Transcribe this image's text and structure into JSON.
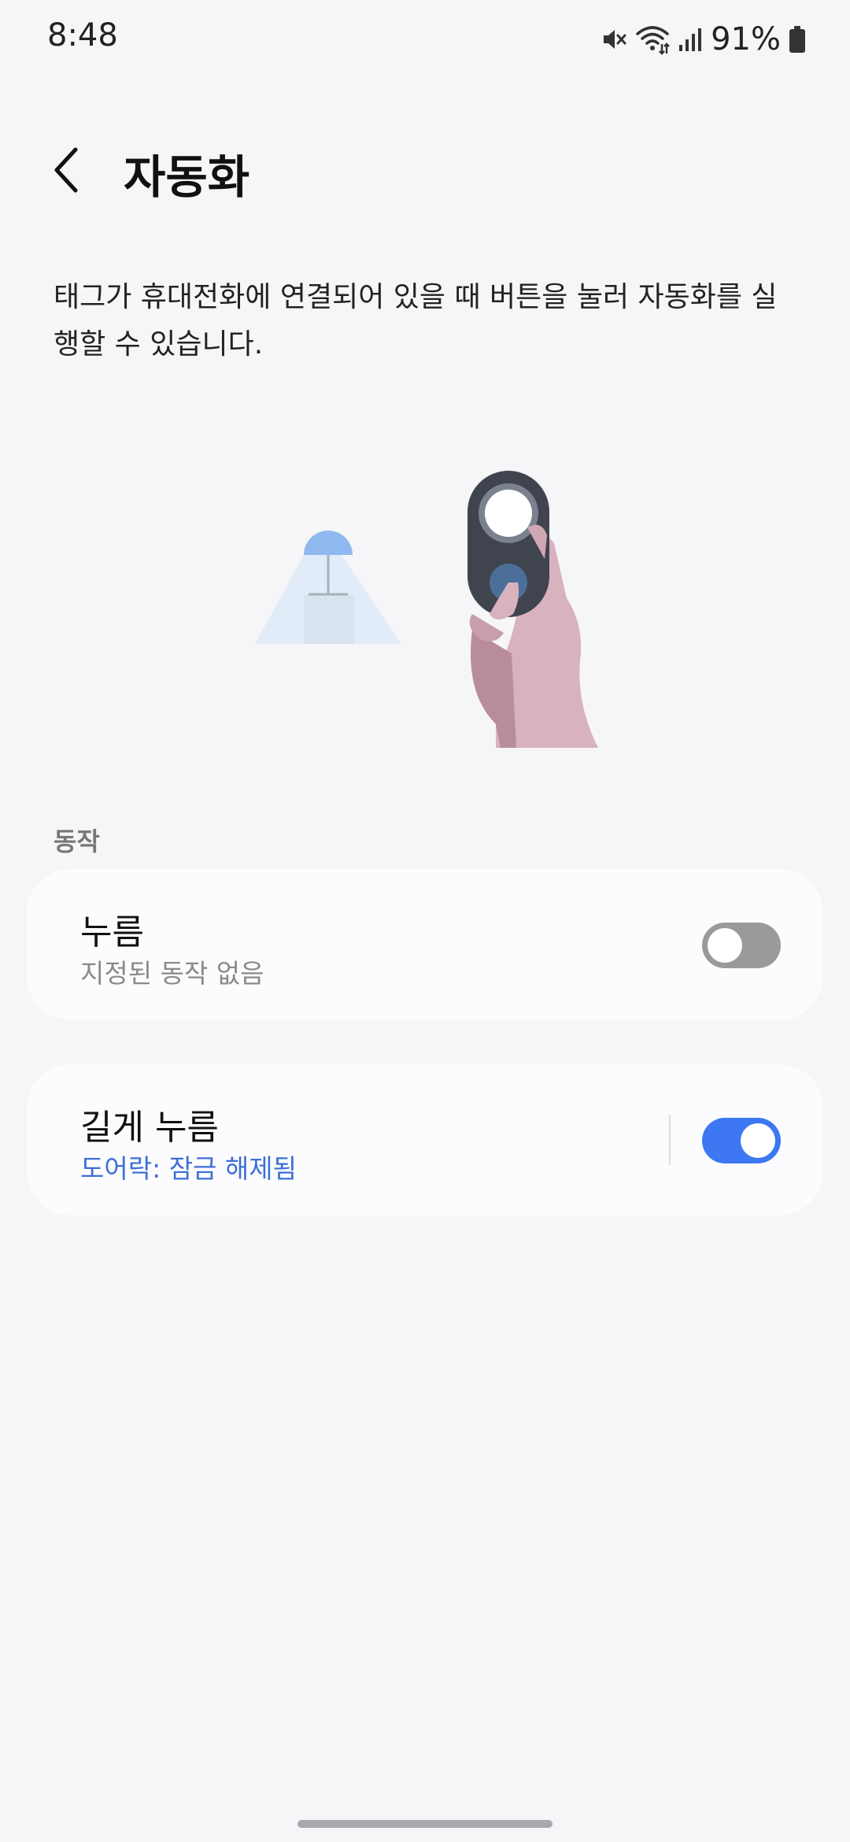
{
  "status_bar": {
    "time": "8:48",
    "battery": "91%",
    "icons": [
      "mute-icon",
      "wifi-icon",
      "signal-icon",
      "battery-icon"
    ]
  },
  "header": {
    "title": "자동화",
    "back_icon": "chevron-left-icon"
  },
  "description": "태그가 휴대전화에 연결되어 있을 때 버튼을 눌러 자동화를 실행할 수 있습니다.",
  "section": {
    "label": "동작"
  },
  "actions": [
    {
      "title": "누름",
      "subtitle": "지정된 동작 없음",
      "enabled": false
    },
    {
      "title": "길게 누름",
      "subtitle": "도어락: 잠금 해제됨",
      "enabled": true
    }
  ],
  "colors": {
    "accent": "#3d77f1",
    "subtitle_active": "#3e6fd5",
    "toggle_off": "#9a9a9d",
    "background": "#f6f6f8"
  }
}
